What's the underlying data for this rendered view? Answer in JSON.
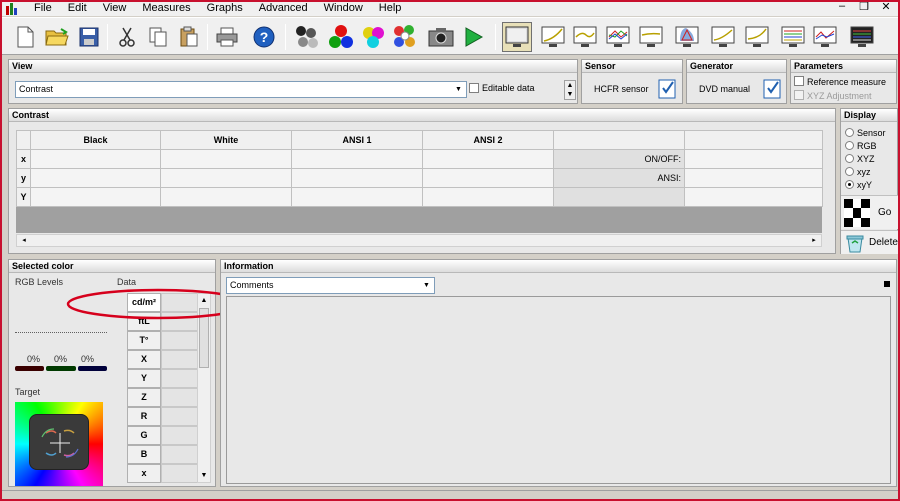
{
  "menu": [
    "File",
    "Edit",
    "View",
    "Measures",
    "Graphs",
    "Advanced",
    "Window",
    "Help"
  ],
  "toolbar": {
    "icons": [
      "new-file-icon",
      "open-folder-icon",
      "save-icon",
      "cut-icon",
      "copy-icon",
      "paste-icon",
      "print-icon",
      "help-icon",
      "grayscale-spheres-icon",
      "rgb-spheres-icon",
      "color-spheres-icon",
      "multicolor-spheres-icon",
      "camera-icon",
      "play-icon",
      "monitor-view-icon",
      "gamma-graph-icon",
      "luminance-graph-icon",
      "rgb-graph-icon",
      "color-temp-graph-icon",
      "cie-chart-icon",
      "near-black-graph-icon",
      "near-white-graph-icon",
      "saturation-graph-icon",
      "saturation-shift-icon",
      "measures-view-icon"
    ]
  },
  "view_panel": {
    "title": "View",
    "combo_value": "Contrast",
    "editable_label": "Editable data"
  },
  "sensor_panel": {
    "title": "Sensor",
    "name": "HCFR sensor"
  },
  "generator_panel": {
    "title": "Generator",
    "name": "DVD manual"
  },
  "parameters_panel": {
    "title": "Parameters",
    "ref_measure": "Reference measure",
    "xyz_adjust": "XYZ Adjustment"
  },
  "contrast_panel": {
    "title": "Contrast",
    "columns": [
      "Black",
      "White",
      "ANSI 1",
      "ANSI 2"
    ],
    "rows": [
      "x",
      "y",
      "Y"
    ],
    "right_labels": [
      "ON/OFF:",
      "ANSI:"
    ]
  },
  "display_panel": {
    "title": "Display",
    "options": [
      "Sensor",
      "RGB",
      "XYZ",
      "xyz",
      "xyY"
    ],
    "selected": "xyY",
    "go_label": "Go",
    "delete_label": "Delete"
  },
  "selected_color": {
    "title": "Selected color",
    "rgb_levels_label": "RGB Levels",
    "data_label": "Data",
    "levels": [
      "0%",
      "0%",
      "0%"
    ],
    "target_label": "Target",
    "data_rows": [
      "cd/m²",
      "ftL",
      "T°",
      "X",
      "Y",
      "Z",
      "R",
      "G",
      "B",
      "x"
    ]
  },
  "information": {
    "title": "Information",
    "combo_value": "Comments"
  },
  "colors": {
    "annotation_red": "#d6001c",
    "panel_bg": "#e8e8e8"
  }
}
